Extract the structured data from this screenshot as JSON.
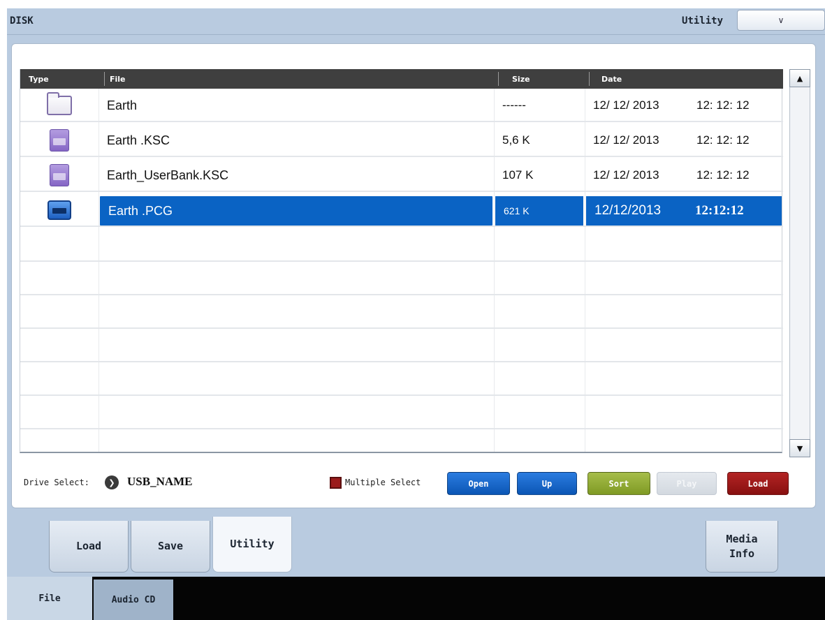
{
  "header": {
    "title": "DISK",
    "page_label": "Utility",
    "menu_button_symbol": "∨"
  },
  "file_table": {
    "columns": [
      "Type",
      "File",
      "Size",
      "Date"
    ],
    "rows": [
      {
        "type_icon": "folder-icon",
        "file": "Earth",
        "size": "------",
        "date": "12/ 12/ 2013",
        "time": "12: 12: 12",
        "selected": false
      },
      {
        "type_icon": "ksc-file-icon",
        "file": "Earth .KSC",
        "size": "5,6 K",
        "date": "12/ 12/ 2013",
        "time": "12: 12: 12",
        "selected": false
      },
      {
        "type_icon": "ksc-file-icon",
        "file": "Earth_UserBank.KSC",
        "size": "107 K",
        "date": "12/ 12/ 2013",
        "time": "12: 12: 12",
        "selected": false
      },
      {
        "type_icon": "pcg-file-icon",
        "file": "Earth .PCG",
        "size": "621 K",
        "date": "12/12/2013",
        "time": "12:12:12",
        "selected": true
      }
    ]
  },
  "scrollbar": {
    "up_symbol": "▲",
    "down_symbol": "▼"
  },
  "controls": {
    "drive_select_label": "Drive Select:",
    "drive_icon_symbol": "❯",
    "drive_name": "USB_NAME",
    "multiple_select_label": "Multiple Select",
    "buttons": {
      "open": "Open",
      "up": "Up",
      "sort": "Sort",
      "play": "Play",
      "load": "Load"
    }
  },
  "page_tabs": {
    "load": "Load",
    "save": "Save",
    "utility": "Utility",
    "media_info_line1": "Media",
    "media_info_line2": "Info"
  },
  "mode_tabs": {
    "file": "File",
    "audio_cd": "Audio CD"
  },
  "colors": {
    "frame": "#b9cbe0",
    "selection": "#0a63c4",
    "button_blue": "#0b56b5",
    "button_green": "#7f9a24",
    "button_red": "#881010"
  }
}
